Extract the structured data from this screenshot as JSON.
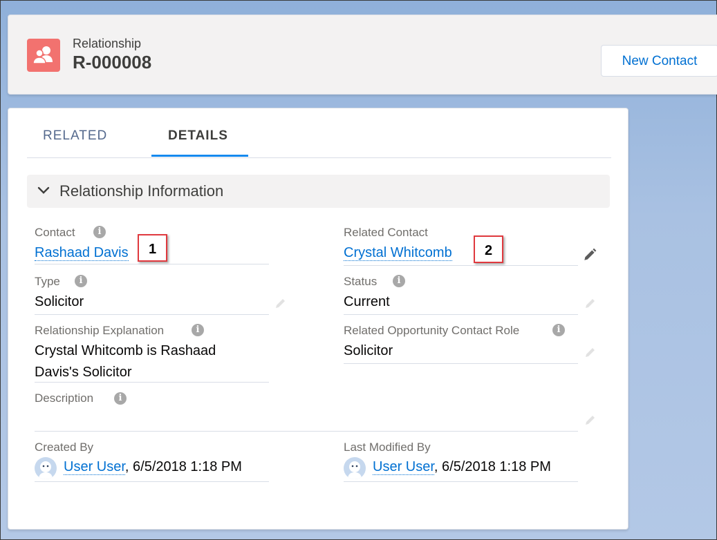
{
  "header": {
    "object_type": "Relationship",
    "record_name": "R-000008",
    "record_icon": "relationship-icon",
    "new_contact_label": "New Contact",
    "brand_color": "#f2726f"
  },
  "tabs": [
    {
      "label": "RELATED",
      "active": false
    },
    {
      "label": "DETAILS",
      "active": true
    }
  ],
  "section": {
    "title": "Relationship Information",
    "expanded": true
  },
  "fields": {
    "contact": {
      "label": "Contact",
      "value": "Rashaad Davis"
    },
    "related_contact": {
      "label": "Related Contact",
      "value": "Crystal Whitcomb"
    },
    "type": {
      "label": "Type",
      "value": "Solicitor"
    },
    "status": {
      "label": "Status",
      "value": "Current"
    },
    "relationship_explanation": {
      "label": "Relationship Explanation",
      "value_line1": "Crystal Whitcomb is Rashaad",
      "value_line2": "Davis's Solicitor"
    },
    "related_opportunity_contact_role": {
      "label": "Related Opportunity Contact Role",
      "value": "Solicitor"
    },
    "description": {
      "label": "Description",
      "value": ""
    },
    "created_by": {
      "label": "Created By",
      "user": "User User",
      "timestamp": ", 6/5/2018 1:18 PM"
    },
    "last_modified_by": {
      "label": "Last Modified By",
      "user": "User User",
      "timestamp": ", 6/5/2018 1:18 PM"
    }
  },
  "callouts": [
    "1",
    "2"
  ],
  "colors": {
    "link": "#0070d2",
    "tab_active_underline": "#1589ee",
    "callout_border": "#e0393e"
  }
}
